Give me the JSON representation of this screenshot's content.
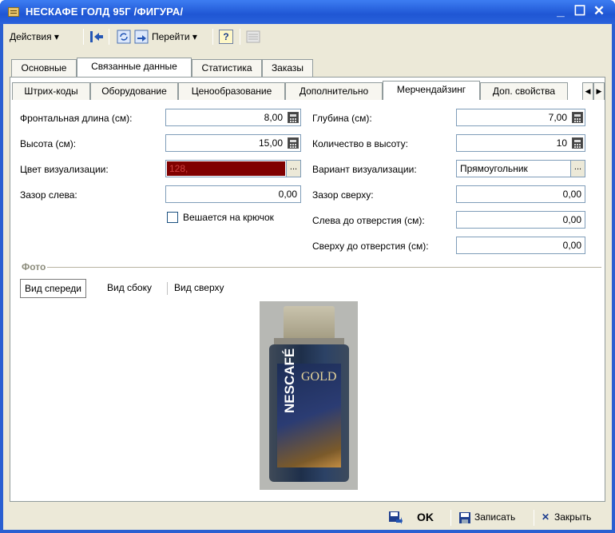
{
  "window": {
    "title": "НЕСКАФЕ ГОЛД 95Г /ФИГУРА/"
  },
  "toolbar": {
    "actions": "Действия ▾",
    "goto": "Перейти ▾",
    "help": "?"
  },
  "main_tabs": [
    "Основные",
    "Связанные данные",
    "Статистика",
    "Заказы"
  ],
  "sub_tabs": [
    "Штрих-коды",
    "Оборудование",
    "Ценообразование",
    "Дополнительно",
    "Мерчендайзинг",
    "Доп. свойства"
  ],
  "form": {
    "front_length": {
      "label": "Фронтальная длина (см):",
      "value": "8,00"
    },
    "height": {
      "label": "Высота (см):",
      "value": "15,00"
    },
    "color": {
      "label": "Цвет визуализации:",
      "value": "128,",
      "swatch": "#800000"
    },
    "gap_left": {
      "label": "Зазор слева:",
      "value": "0,00"
    },
    "hook": {
      "label": "Вешается на крючок"
    },
    "depth": {
      "label": "Глубина (см):",
      "value": "7,00"
    },
    "count_height": {
      "label": "Количество в высоту:",
      "value": "10"
    },
    "viz_variant": {
      "label": "Вариант визуализации:",
      "value": "Прямоугольник"
    },
    "gap_top": {
      "label": "Зазор сверху:",
      "value": "0,00"
    },
    "left_to_hole": {
      "label": "Слева до отверстия (см):",
      "value": "0,00"
    },
    "top_to_hole": {
      "label": "Сверху до отверстия (см):",
      "value": "0,00"
    }
  },
  "photo": {
    "section_title": "Фото",
    "views": [
      "Вид спереди",
      "Вид сбоку",
      "Вид сверху"
    ],
    "label_brand": "NESCAFÉ",
    "label_gold": "GOLD"
  },
  "footer": {
    "ok": "OK",
    "save": "Записать",
    "close": "Закрыть"
  },
  "colors": {
    "title_bar": "#2a5fd1",
    "frame": "#ece9d8"
  }
}
